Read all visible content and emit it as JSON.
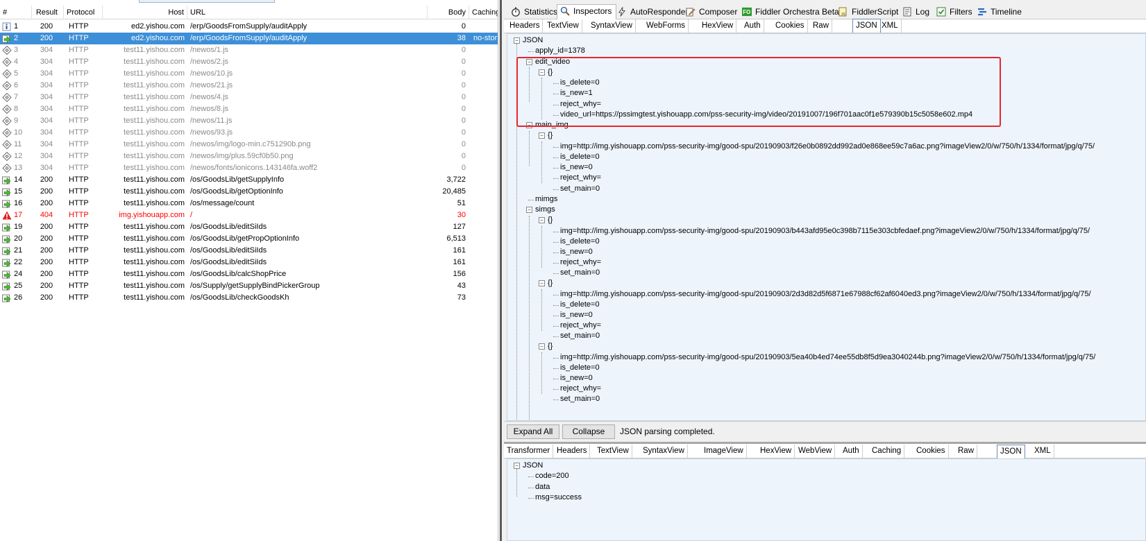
{
  "sessions": {
    "columns": [
      "#",
      "Result",
      "Protocol",
      "Host",
      "URL",
      "Body",
      "Caching"
    ],
    "rows": [
      {
        "num": "1",
        "result": "200",
        "protocol": "HTTP",
        "host": "ed2.yishou.com",
        "url": "/erp/GoodsFromSupply/auditApply",
        "body": "0",
        "caching": "",
        "icon": "info-icon",
        "state": "normal"
      },
      {
        "num": "2",
        "result": "200",
        "protocol": "HTTP",
        "host": "ed2.yishou.com",
        "url": "/erp/GoodsFromSupply/auditApply",
        "body": "38",
        "caching": "no-stor",
        "icon": "response-arrow-icon",
        "state": "selected"
      },
      {
        "num": "3",
        "result": "304",
        "protocol": "HTTP",
        "host": "test11.yishou.com",
        "url": "/newos/1.js",
        "body": "0",
        "caching": "",
        "icon": "diamond-icon",
        "state": "gray"
      },
      {
        "num": "4",
        "result": "304",
        "protocol": "HTTP",
        "host": "test11.yishou.com",
        "url": "/newos/2.js",
        "body": "0",
        "caching": "",
        "icon": "diamond-icon",
        "state": "gray"
      },
      {
        "num": "5",
        "result": "304",
        "protocol": "HTTP",
        "host": "test11.yishou.com",
        "url": "/newos/10.js",
        "body": "0",
        "caching": "",
        "icon": "diamond-icon",
        "state": "gray"
      },
      {
        "num": "6",
        "result": "304",
        "protocol": "HTTP",
        "host": "test11.yishou.com",
        "url": "/newos/21.js",
        "body": "0",
        "caching": "",
        "icon": "diamond-icon",
        "state": "gray"
      },
      {
        "num": "7",
        "result": "304",
        "protocol": "HTTP",
        "host": "test11.yishou.com",
        "url": "/newos/4.js",
        "body": "0",
        "caching": "",
        "icon": "diamond-icon",
        "state": "gray"
      },
      {
        "num": "8",
        "result": "304",
        "protocol": "HTTP",
        "host": "test11.yishou.com",
        "url": "/newos/8.js",
        "body": "0",
        "caching": "",
        "icon": "diamond-icon",
        "state": "gray"
      },
      {
        "num": "9",
        "result": "304",
        "protocol": "HTTP",
        "host": "test11.yishou.com",
        "url": "/newos/11.js",
        "body": "0",
        "caching": "",
        "icon": "diamond-icon",
        "state": "gray"
      },
      {
        "num": "10",
        "result": "304",
        "protocol": "HTTP",
        "host": "test11.yishou.com",
        "url": "/newos/93.js",
        "body": "0",
        "caching": "",
        "icon": "diamond-icon",
        "state": "gray"
      },
      {
        "num": "11",
        "result": "304",
        "protocol": "HTTP",
        "host": "test11.yishou.com",
        "url": "/newos/img/logo-min.c751290b.png",
        "body": "0",
        "caching": "",
        "icon": "diamond-icon",
        "state": "gray"
      },
      {
        "num": "12",
        "result": "304",
        "protocol": "HTTP",
        "host": "test11.yishou.com",
        "url": "/newos/img/plus.59cf0b50.png",
        "body": "0",
        "caching": "",
        "icon": "diamond-icon",
        "state": "gray"
      },
      {
        "num": "13",
        "result": "304",
        "protocol": "HTTP",
        "host": "test11.yishou.com",
        "url": "/newos/fonts/ionicons.143146fa.woff2",
        "body": "0",
        "caching": "",
        "icon": "diamond-icon",
        "state": "gray"
      },
      {
        "num": "14",
        "result": "200",
        "protocol": "HTTP",
        "host": "test11.yishou.com",
        "url": "/os/GoodsLib/getSupplyInfo",
        "body": "3,722",
        "caching": "",
        "icon": "response-arrow-icon",
        "state": "normal"
      },
      {
        "num": "15",
        "result": "200",
        "protocol": "HTTP",
        "host": "test11.yishou.com",
        "url": "/os/GoodsLib/getOptionInfo",
        "body": "20,485",
        "caching": "",
        "icon": "response-arrow-icon",
        "state": "normal"
      },
      {
        "num": "16",
        "result": "200",
        "protocol": "HTTP",
        "host": "test11.yishou.com",
        "url": "/os/message/count",
        "body": "51",
        "caching": "",
        "icon": "response-arrow-icon",
        "state": "normal"
      },
      {
        "num": "17",
        "result": "404",
        "protocol": "HTTP",
        "host": "img.yishouapp.com",
        "url": "/",
        "body": "30",
        "caching": "",
        "icon": "warning-icon",
        "state": "error"
      },
      {
        "num": "19",
        "result": "200",
        "protocol": "HTTP",
        "host": "test11.yishou.com",
        "url": "/os/GoodsLib/editSiIds",
        "body": "127",
        "caching": "",
        "icon": "response-arrow-icon",
        "state": "normal"
      },
      {
        "num": "20",
        "result": "200",
        "protocol": "HTTP",
        "host": "test11.yishou.com",
        "url": "/os/GoodsLib/getPropOptionInfo",
        "body": "6,513",
        "caching": "",
        "icon": "response-arrow-icon",
        "state": "normal"
      },
      {
        "num": "21",
        "result": "200",
        "protocol": "HTTP",
        "host": "test11.yishou.com",
        "url": "/os/GoodsLib/editSiIds",
        "body": "161",
        "caching": "",
        "icon": "response-arrow-icon",
        "state": "normal"
      },
      {
        "num": "22",
        "result": "200",
        "protocol": "HTTP",
        "host": "test11.yishou.com",
        "url": "/os/GoodsLib/editSiIds",
        "body": "161",
        "caching": "",
        "icon": "response-arrow-icon",
        "state": "normal"
      },
      {
        "num": "24",
        "result": "200",
        "protocol": "HTTP",
        "host": "test11.yishou.com",
        "url": "/os/GoodsLib/calcShopPrice",
        "body": "156",
        "caching": "",
        "icon": "response-arrow-icon",
        "state": "normal"
      },
      {
        "num": "25",
        "result": "200",
        "protocol": "HTTP",
        "host": "test11.yishou.com",
        "url": "/os/Supply/getSupplyBindPickerGroup",
        "body": "43",
        "caching": "",
        "icon": "response-arrow-icon",
        "state": "normal"
      },
      {
        "num": "26",
        "result": "200",
        "protocol": "HTTP",
        "host": "test11.yishou.com",
        "url": "/os/GoodsLib/checkGoodsKh",
        "body": "73",
        "caching": "",
        "icon": "response-arrow-icon",
        "state": "normal"
      }
    ]
  },
  "main_tabs": [
    {
      "label": "Statistics",
      "icon": "stopwatch-icon",
      "active": false
    },
    {
      "label": "Inspectors",
      "icon": "magnifier-icon",
      "active": true
    },
    {
      "label": "AutoResponder",
      "icon": "lightning-icon",
      "active": false
    },
    {
      "label": "Composer",
      "icon": "pencil-icon",
      "active": false
    },
    {
      "label": "Fiddler Orchestra Beta",
      "icon": "fo-icon",
      "active": false
    },
    {
      "label": "FiddlerScript",
      "icon": "script-icon",
      "active": false
    },
    {
      "label": "Log",
      "icon": "log-icon",
      "active": false
    },
    {
      "label": "Filters",
      "icon": "checkbox-icon",
      "active": false
    },
    {
      "label": "Timeline",
      "icon": "timeline-icon",
      "active": false
    }
  ],
  "request_tabs": [
    "Headers",
    "TextView",
    "SyntaxView",
    "WebForms",
    "HexView",
    "Auth",
    "Cookies",
    "Raw",
    "JSON",
    "XML"
  ],
  "request_tabs_active": "JSON",
  "request_tree": {
    "root": "JSON",
    "lines": [
      "apply_id=1378",
      "edit_video",
      "{}",
      "is_delete=0",
      "is_new=1",
      "reject_why=",
      "video_url=https://pssimgtest.yishouapp.com/pss-security-img/video/20191007/196f701aac0f1e579390b15c5058e602.mp4",
      "main_img",
      "{}",
      "img=http://img.yishouapp.com/pss-security-img/good-spu/20190903/f26e0b0892dd992ad0e868ee59c7a6ac.png?imageView2/0/w/750/h/1334/format/jpg/q/75/",
      "is_delete=0",
      "is_new=0",
      "reject_why=",
      "set_main=0",
      "mimgs",
      "simgs",
      "{}",
      "img=http://img.yishouapp.com/pss-security-img/good-spu/20190903/b443afd95e0c398b7115e303cbfedaef.png?imageView2/0/w/750/h/1334/format/jpg/q/75/",
      "is_delete=0",
      "is_new=0",
      "reject_why=",
      "set_main=0",
      "{}",
      "img=http://img.yishouapp.com/pss-security-img/good-spu/20190903/2d3d82d5f6871e67988cf62af6040ed3.png?imageView2/0/w/750/h/1334/format/jpg/q/75/",
      "is_delete=0",
      "is_new=0",
      "reject_why=",
      "set_main=0",
      "{}",
      "img=http://img.yishouapp.com/pss-security-img/good-spu/20190903/5ea40b4ed74ee55db8f5d9ea3040244b.png?imageView2/0/w/750/h/1334/format/jpg/q/75/",
      "is_delete=0",
      "is_new=0",
      "reject_why=",
      "set_main=0"
    ]
  },
  "buttons": {
    "expand_all": "Expand All",
    "collapse": "Collapse"
  },
  "status_text": "JSON parsing completed.",
  "response_tabs": [
    "Transformer",
    "Headers",
    "TextView",
    "SyntaxView",
    "ImageView",
    "HexView",
    "WebView",
    "Auth",
    "Caching",
    "Cookies",
    "Raw",
    "JSON",
    "XML"
  ],
  "response_tabs_active": "JSON",
  "response_tree": {
    "root": "JSON",
    "lines": [
      "code=200",
      "data",
      "msg=success"
    ]
  },
  "colors": {
    "selection": "#3d8fd8",
    "tree_background": "#edf4fc",
    "highlight_box": "#e8262d",
    "error_text": "#ff0000"
  }
}
